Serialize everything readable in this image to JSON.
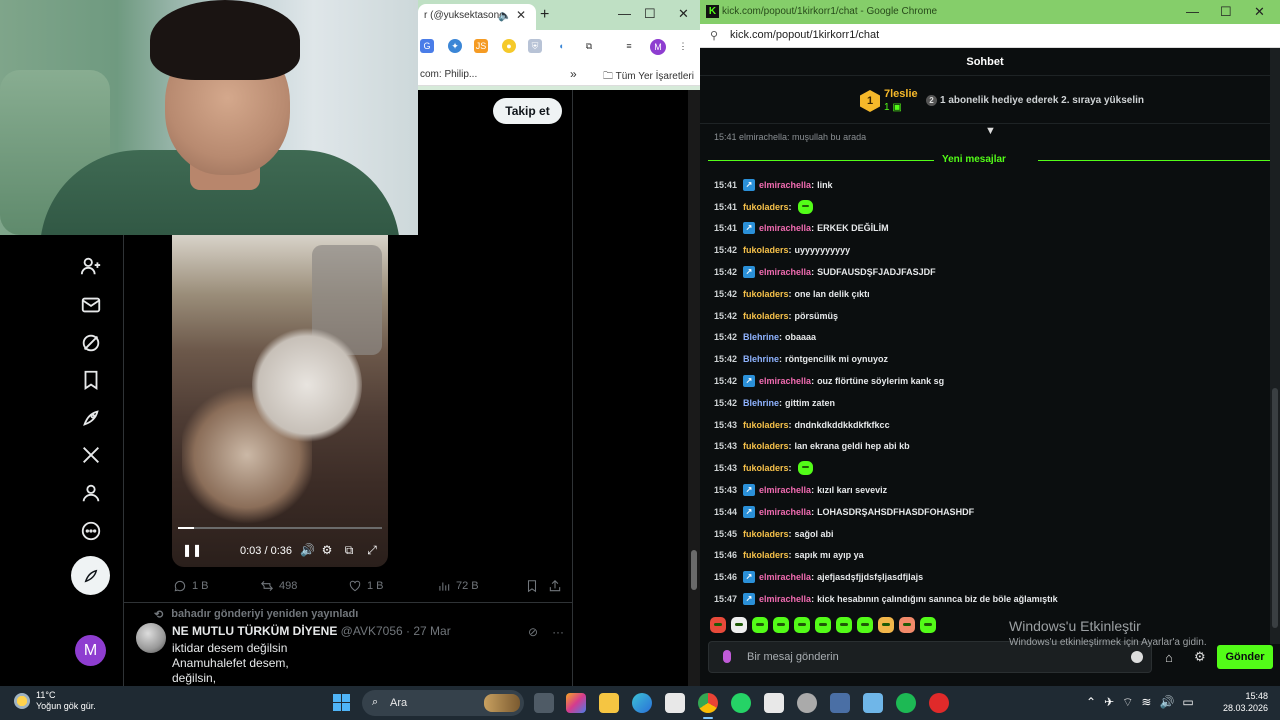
{
  "x_window": {
    "tab_title": "r (@yuksektasone",
    "bookmark_1": "com: Philip...",
    "bookmarks_folder": "Tüm Yer İşaretleri",
    "profile_initial": "M",
    "follow_label": "Takip et",
    "video": {
      "time": "0:03 / 0:36",
      "progress": 0.08
    },
    "actions": {
      "replies": "1 B",
      "reposts": "498",
      "likes": "1 B",
      "views": "72 B"
    },
    "tweet2": {
      "repost_line": "bahadır gönderiyi yeniden yayınladı",
      "name": "NE MUTLU TÜRKÜM DİYENE",
      "handle": "@AVK7056",
      "date": "· 27 Mar",
      "line1": "iktidar desem değilsin",
      "line2": "Anamuhalefet desem,",
      "line3": "değilsin,"
    },
    "sidebar_profile_initial": "M"
  },
  "kick": {
    "window_title": "kick.com/popout/1kirkorr1/chat - Google Chrome",
    "url": "kick.com/popout/1kirkorr1/chat",
    "chat_title": "Sohbet",
    "leader": {
      "rank": "1",
      "name": "7leslie",
      "subs": "1",
      "hint_num": "2",
      "hint": "1 abonelik hediye ederek 2. sıraya yükselin"
    },
    "partial_message": "15:41  elmirachella: muşullah bu arada",
    "new_messages_label": "Yeni mesajlar",
    "messages": [
      {
        "time": "15:41",
        "user": "elmirachella",
        "color": "#f06bb0",
        "badge": true,
        "text": "link"
      },
      {
        "time": "15:41",
        "user": "fukoladers",
        "color": "#f5c04a",
        "badge": false,
        "text": "",
        "emote": true
      },
      {
        "time": "15:41",
        "user": "elmirachella",
        "color": "#f06bb0",
        "badge": true,
        "text": "ERKEK DEĞİLİM"
      },
      {
        "time": "15:42",
        "user": "fukoladers",
        "color": "#f5c04a",
        "badge": false,
        "text": "uyyyyyyyyyy"
      },
      {
        "time": "15:42",
        "user": "elmirachella",
        "color": "#f06bb0",
        "badge": true,
        "text": "SUDFAUSDŞFJADJFASJDF"
      },
      {
        "time": "15:42",
        "user": "fukoladers",
        "color": "#f5c04a",
        "badge": false,
        "text": "one lan delik çıktı"
      },
      {
        "time": "15:42",
        "user": "fukoladers",
        "color": "#f5c04a",
        "badge": false,
        "text": "pörsümüş"
      },
      {
        "time": "15:42",
        "user": "Blehrine",
        "color": "#8fb3ff",
        "badge": false,
        "text": "obaaaa"
      },
      {
        "time": "15:42",
        "user": "Blehrine",
        "color": "#8fb3ff",
        "badge": false,
        "text": "röntgencilik mi oynuyoz"
      },
      {
        "time": "15:42",
        "user": "elmirachella",
        "color": "#f06bb0",
        "badge": true,
        "text": "ouz flörtüne söylerim kank sg"
      },
      {
        "time": "15:42",
        "user": "Blehrine",
        "color": "#8fb3ff",
        "badge": false,
        "text": "gittim zaten"
      },
      {
        "time": "15:43",
        "user": "fukoladers",
        "color": "#f5c04a",
        "badge": false,
        "text": "dndnkdkddkkdkfkfkcc"
      },
      {
        "time": "15:43",
        "user": "fukoladers",
        "color": "#f5c04a",
        "badge": false,
        "text": "lan ekrana geldi hep abi kb"
      },
      {
        "time": "15:43",
        "user": "fukoladers",
        "color": "#f5c04a",
        "badge": false,
        "text": "",
        "emote": true
      },
      {
        "time": "15:43",
        "user": "elmirachella",
        "color": "#f06bb0",
        "badge": true,
        "text": "kızıl karı seveviz"
      },
      {
        "time": "15:44",
        "user": "elmirachella",
        "color": "#f06bb0",
        "badge": true,
        "text": "LOHASDRŞAHSDFHASDFOHASHDF"
      },
      {
        "time": "15:45",
        "user": "fukoladers",
        "color": "#f5c04a",
        "badge": false,
        "text": "sağol abi"
      },
      {
        "time": "15:46",
        "user": "fukoladers",
        "color": "#f5c04a",
        "badge": false,
        "text": "sapık mı ayıp ya"
      },
      {
        "time": "15:46",
        "user": "elmirachella",
        "color": "#f06bb0",
        "badge": true,
        "text": "ajefjasdşfjjdsfşljasdfjlajs"
      },
      {
        "time": "15:47",
        "user": "elmirachella",
        "color": "#f06bb0",
        "badge": true,
        "text": "kick hesabının çalındığını sanınca biz de böle ağlamıştık"
      }
    ],
    "input_placeholder": "Bir mesaj gönderin",
    "send_label": "Gönder"
  },
  "windows_activation": {
    "title": "Windows'u Etkinleştir",
    "subtitle": "Windows'u etkinleştirmek için Ayarlar'a gidin."
  },
  "taskbar": {
    "weather_temp": "11°C",
    "weather_desc": "Yoğun gök gür.",
    "search_label": "Ara",
    "time": "15:48",
    "date": "28.03.2026"
  }
}
